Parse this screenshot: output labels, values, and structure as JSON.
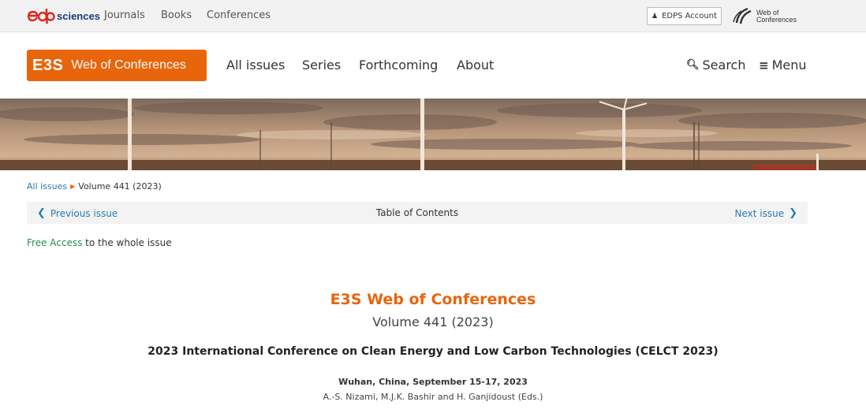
{
  "topbar": {
    "publisher": "sciences",
    "links": [
      "Journals",
      "Books",
      "Conferences"
    ],
    "account_label": "EDPS Account",
    "wof_logo": {
      "line1": "Web of",
      "line2": "Conferences"
    }
  },
  "header": {
    "brand_abbr": "E3S",
    "brand_name": "Web of Conferences",
    "nav": [
      "All issues",
      "Series",
      "Forthcoming",
      "About"
    ],
    "search_label": "Search",
    "menu_label": "Menu"
  },
  "breadcrumb": {
    "root": "All issues",
    "current": "Volume 441 (2023)"
  },
  "toc": {
    "prev": "Previous issue",
    "title": "Table of Contents",
    "next": "Next issue"
  },
  "access": {
    "free": "Free Access",
    "rest": " to the whole issue"
  },
  "issue": {
    "journal": "E3S Web of Conferences",
    "volume": "Volume 441 (2023)",
    "conference": "2023 International Conference on Clean Energy and Low Carbon Technologies (CELCT 2023)",
    "place": "Wuhan, China, September 15-17, 2023",
    "editors": "A.-S. Nizami, M.J.K. Bashir and H. Ganjidoust (Eds.)"
  },
  "colors": {
    "accent": "#e8650c",
    "link": "#2a7ab0",
    "free": "#2a8a4a"
  },
  "icons": [
    "edp-logo-icon",
    "user-icon",
    "web-of-conferences-logo-icon",
    "search-icon",
    "menu-icon",
    "chevron-left-icon",
    "chevron-right-icon",
    "breadcrumb-arrow-icon"
  ]
}
